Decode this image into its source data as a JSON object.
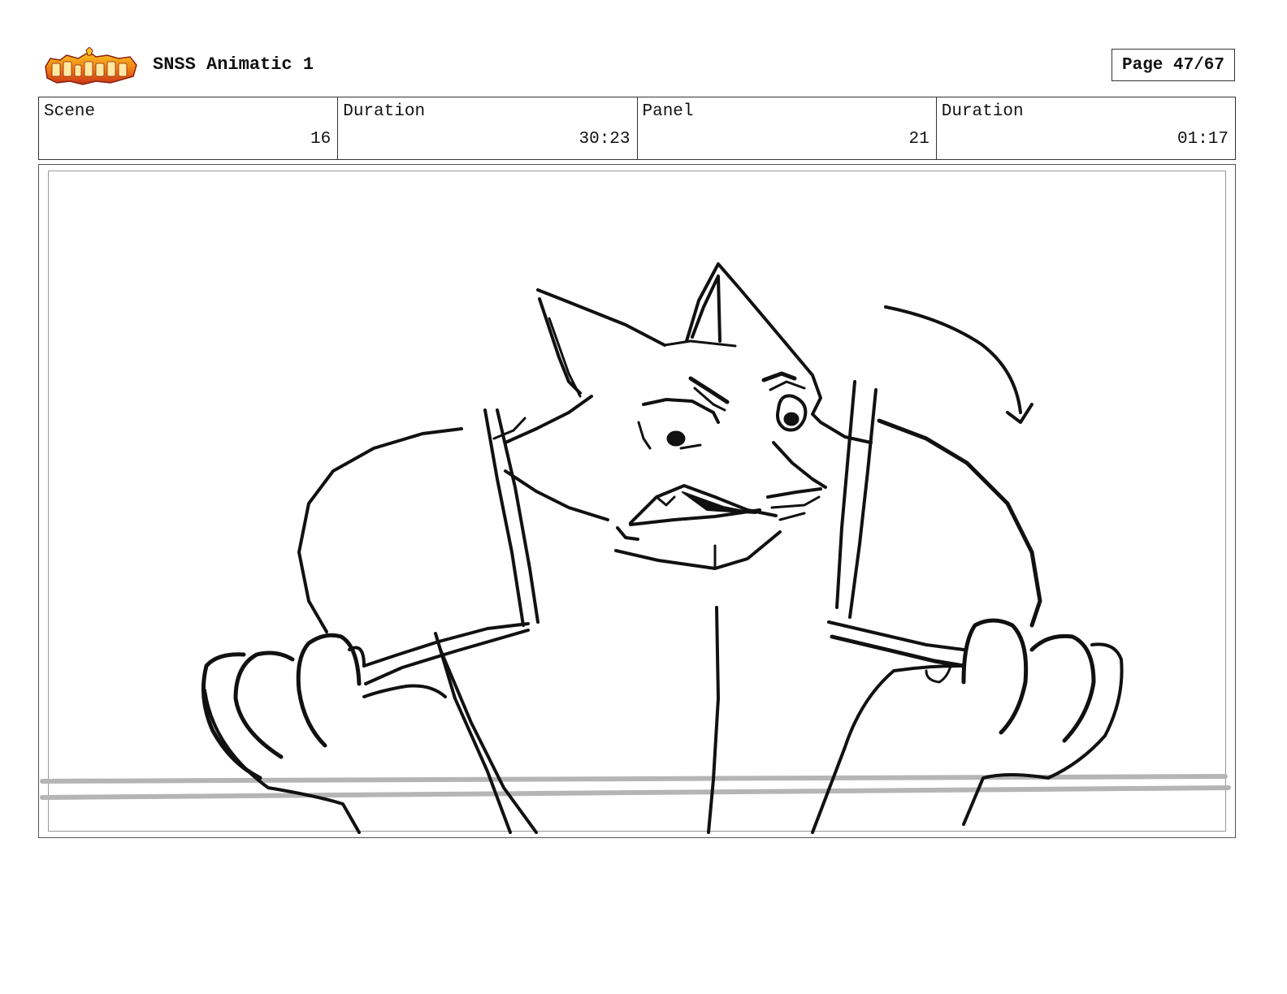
{
  "header": {
    "logo_icon": "show-logo-icon",
    "title": "SNSS Animatic 1",
    "page_label": "Page 47/67"
  },
  "info": {
    "scene_label": "Scene",
    "scene_value": "16",
    "scene_duration_label": "Duration",
    "scene_duration_value": "30:23",
    "panel_label": "Panel",
    "panel_value": "21",
    "panel_duration_label": "Duration",
    "panel_duration_value": "01:17"
  },
  "panel": {
    "sketch_icon": "storyboard-sketch-image",
    "colors": {
      "ink": "#111111",
      "ground_line": "#b5b5b5"
    }
  },
  "logo_colors": {
    "orange": "#f07a12",
    "red": "#c8321a",
    "yellow": "#f7c521"
  }
}
